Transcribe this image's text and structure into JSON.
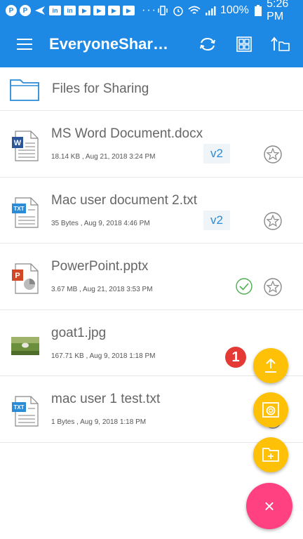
{
  "status_bar": {
    "battery": "100%",
    "time": "5:26 PM",
    "dots": "···"
  },
  "app_bar": {
    "title": "EveryoneShar…"
  },
  "folder": {
    "label": "Files for Sharing"
  },
  "files": [
    {
      "name": "MS Word Document.docx",
      "meta": "18.14 KB , Aug 21, 2018 3:24 PM",
      "version": "v2",
      "type_label": "W"
    },
    {
      "name": "Mac user document 2.txt",
      "meta": "35 Bytes , Aug 9, 2018 4:46 PM",
      "version": "v2",
      "type_label": "TXT"
    },
    {
      "name": "PowerPoint.pptx",
      "meta": "3.67 MB , Aug 21, 2018 3:53 PM",
      "version": "",
      "type_label": "P"
    },
    {
      "name": "goat1.jpg",
      "meta": "167.71 KB , Aug 9, 2018 1:18 PM",
      "version": "",
      "type_label": ""
    },
    {
      "name": "mac user 1 test.txt",
      "meta": "1 Bytes , Aug 9, 2018 1:18 PM",
      "version": "",
      "type_label": "TXT"
    }
  ],
  "step_badge": "1",
  "fab": {
    "close_symbol": "×"
  },
  "colors": {
    "primary": "#1e88e5",
    "fab_mini": "#ffc107",
    "fab_main": "#ff4081",
    "badge": "#e53935",
    "check": "#4caf50"
  }
}
